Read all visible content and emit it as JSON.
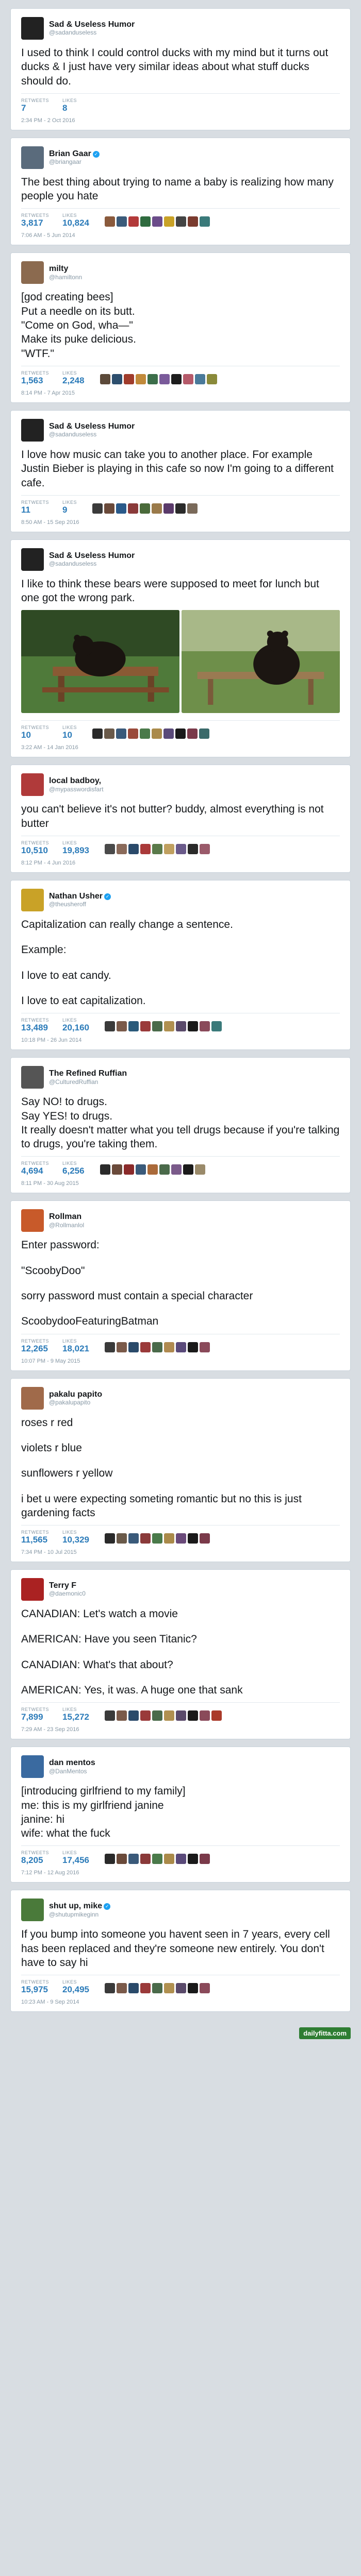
{
  "tweets": [
    {
      "name": "Sad & Useless Humor",
      "handle": "@sadanduseless",
      "verified": false,
      "avatar_color": "#222222",
      "text": [
        "I used to think I could control ducks with my mind but it turns out ducks & I just have very similar ideas about what stuff ducks should do."
      ],
      "retweets_label": "RETWEETS",
      "retweets": "7",
      "likes_label": "LIKES",
      "likes": "8",
      "liker_colors": [],
      "time": "2:34 PM - 2 Oct 2016"
    },
    {
      "name": "Brian Gaar",
      "handle": "@briangaar",
      "verified": true,
      "avatar_color": "#5a6b7c",
      "text": [
        "The best thing about trying to name a baby is realizing how many people you hate"
      ],
      "retweets_label": "RETWEETS",
      "retweets": "3,817",
      "likes_label": "LIKES",
      "likes": "10,824",
      "liker_colors": [
        "#8a5a3c",
        "#3b5b7a",
        "#b33a3a",
        "#2f6b3f",
        "#6b4c8a",
        "#c9a227",
        "#444444",
        "#7a3b2e",
        "#3a7a7a"
      ],
      "time": "7:06 AM - 5 Jun 2014"
    },
    {
      "name": "milty",
      "handle": "@hamiltonn",
      "verified": false,
      "avatar_color": "#8b6a4f",
      "text": [
        "[god creating bees]",
        "Put a needle on its butt.",
        "\"Come on God, wha—\"",
        "Make its puke delicious.",
        "\"WTF.\""
      ],
      "retweets_label": "RETWEETS",
      "retweets": "1,563",
      "likes_label": "LIKES",
      "likes": "2,248",
      "liker_colors": [
        "#5c4a3a",
        "#2d4f6e",
        "#a03c2c",
        "#c18a3b",
        "#3c6e4a",
        "#7a5a9a",
        "#1d1d1d",
        "#b55a6a",
        "#4a7a9a",
        "#8a8a3a"
      ],
      "time": "8:14 PM - 7 Apr 2015"
    },
    {
      "name": "Sad & Useless Humor",
      "handle": "@sadanduseless",
      "verified": false,
      "avatar_color": "#222222",
      "text": [
        "I love how music can take you to another place. For example Justin Bieber is playing in this cafe so now I'm going to a different cafe."
      ],
      "retweets_label": "RETWEETS",
      "retweets": "11",
      "likes_label": "LIKES",
      "likes": "9",
      "liker_colors": [
        "#3a3a3a",
        "#6a4a3a",
        "#2a5a8a",
        "#8a3a3a",
        "#4a6a3a",
        "#9a7a4a",
        "#5a3a6a",
        "#2a2a2a",
        "#7a6a5a"
      ],
      "time": "8:50 AM - 15 Sep 2016"
    },
    {
      "name": "Sad & Useless Humor",
      "handle": "@sadanduseless",
      "verified": false,
      "avatar_color": "#222222",
      "text": [
        "I like to think these bears were supposed to meet for lunch but one got the wrong park."
      ],
      "photos": true,
      "retweets_label": "RETWEETS",
      "retweets": "10",
      "likes_label": "LIKES",
      "likes": "10",
      "liker_colors": [
        "#2a2a2a",
        "#6a5a4a",
        "#3a5a7a",
        "#9a4a3a",
        "#4a7a4a",
        "#aa8a4a",
        "#5a4a7a",
        "#1a1a1a",
        "#7a3a4a",
        "#3a6a6a"
      ],
      "time": "3:22 AM - 14 Jan 2016"
    },
    {
      "name": "local badboy,",
      "handle": "@mypasswordisfart",
      "verified": false,
      "avatar_color": "#b03a3a",
      "text": [
        "you can't believe it's not butter? buddy, almost everything is not butter"
      ],
      "retweets_label": "RETWEETS",
      "retweets": "10,510",
      "likes_label": "LIKES",
      "likes": "19,893",
      "liker_colors": [
        "#4a4a4a",
        "#8a6a5a",
        "#2a4a6a",
        "#aa3a3a",
        "#5a7a4a",
        "#c0a060",
        "#6a5a8a",
        "#2a2a2a",
        "#9a5a6a"
      ],
      "time": "8:12 PM - 4 Jun 2016"
    },
    {
      "name": "Nathan Usher",
      "handle": "@theusheroff",
      "verified": true,
      "avatar_color": "#c9a227",
      "text": [
        "Capitalization can really change a sentence.",
        "",
        "Example:",
        "",
        "I love to eat candy.",
        "",
        "I love to eat capitalization."
      ],
      "retweets_label": "RETWEETS",
      "retweets": "13,489",
      "likes_label": "LIKES",
      "likes": "20,160",
      "liker_colors": [
        "#3a3a3a",
        "#7a5a4a",
        "#2a5a7a",
        "#9a3a3a",
        "#4a6a4a",
        "#b09050",
        "#5a4a6a",
        "#1a1a1a",
        "#8a4a5a",
        "#3a7a7a"
      ],
      "time": "10:18 PM - 26 Jun 2014"
    },
    {
      "name": "The Refined Ruffian",
      "handle": "@CulturedRuffian",
      "verified": false,
      "avatar_color": "#555555",
      "text": [
        "Say NO! to drugs.",
        "Say YES! to drugs.",
        "It really doesn't matter what you tell drugs because if you're talking to drugs, you're taking them."
      ],
      "retweets_label": "RETWEETS",
      "retweets": "4,694",
      "likes_label": "LIKES",
      "likes": "6,256",
      "liker_colors": [
        "#2a2a2a",
        "#6a4a3a",
        "#8a2a2a",
        "#3a5a7a",
        "#aa6a3a",
        "#4a6a4a",
        "#7a5a8a",
        "#1a1a1a",
        "#9a8a6a"
      ],
      "time": "8:11 PM - 30 Aug 2015"
    },
    {
      "name": "Rollman",
      "handle": "@Rollmanlol",
      "verified": false,
      "avatar_color": "#c85a2a",
      "text": [
        "Enter password:",
        "",
        "\"ScoobyDoo\"",
        "",
        "sorry password must contain a special character",
        "",
        "ScoobydooFeaturingBatman"
      ],
      "retweets_label": "RETWEETS",
      "retweets": "12,265",
      "likes_label": "LIKES",
      "likes": "18,021",
      "liker_colors": [
        "#3a3a3a",
        "#7a5a4a",
        "#2a4a6a",
        "#9a3a3a",
        "#4a6a4a",
        "#b08a50",
        "#5a4a7a",
        "#1a1a1a",
        "#8a4a5a"
      ],
      "time": "10:07 PM - 9 May 2015"
    },
    {
      "name": "pakalu papito",
      "handle": "@pakalupapito",
      "verified": false,
      "avatar_color": "#a06a4a",
      "text": [
        "roses r red",
        "",
        "violets r blue",
        "",
        "sunflowers r yellow",
        "",
        "i bet u were expecting someting romantic but no this is just gardening facts"
      ],
      "retweets_label": "RETWEETS",
      "retweets": "11,565",
      "likes_label": "LIKES",
      "likes": "10,329",
      "liker_colors": [
        "#2a2a2a",
        "#6a5a4a",
        "#3a5a7a",
        "#8a3a3a",
        "#4a7a4a",
        "#aa8a4a",
        "#6a4a7a",
        "#1a1a1a",
        "#7a3a4a"
      ],
      "time": "7:34 PM - 10 Jul 2015"
    },
    {
      "name": "Terry F",
      "handle": "@daemonic0",
      "verified": false,
      "avatar_color": "#aa2222",
      "text": [
        "CANADIAN: Let's watch a movie",
        "",
        "AMERICAN: Have you seen Titanic?",
        "",
        "CANADIAN: What's that about?",
        "",
        "AMERICAN: Yes, it was. A huge one that sank"
      ],
      "retweets_label": "RETWEETS",
      "retweets": "7,899",
      "likes_label": "LIKES",
      "likes": "15,272",
      "liker_colors": [
        "#3a3a3a",
        "#7a5a4a",
        "#2a4a6a",
        "#9a3a3a",
        "#4a6a4a",
        "#b09050",
        "#5a4a6a",
        "#1a1a1a",
        "#8a4a5a",
        "#aa3a2a"
      ],
      "time": "7:29 AM - 23 Sep 2016"
    },
    {
      "name": "dan mentos",
      "handle": "@DanMentos",
      "verified": false,
      "avatar_color": "#3a6aa0",
      "text": [
        "[introducing girlfriend to my family]",
        "me: this is my girlfriend janine",
        "janine: hi",
        "wife: what the fuck"
      ],
      "retweets_label": "RETWEETS",
      "retweets": "8,205",
      "likes_label": "LIKES",
      "likes": "17,456",
      "liker_colors": [
        "#2a2a2a",
        "#6a4a3a",
        "#3a5a7a",
        "#8a3a3a",
        "#4a7a4a",
        "#aa8a4a",
        "#5a4a7a",
        "#1a1a1a",
        "#7a3a4a"
      ],
      "time": "7:12 PM - 12 Aug 2016"
    },
    {
      "name": "shut up, mike",
      "handle": "@shutupmikeginn",
      "verified": true,
      "avatar_color": "#4a7a3a",
      "text": [
        "If you bump into someone you havent seen in 7 years, every cell has been replaced and they're someone new entirely. You don't have to say hi"
      ],
      "retweets_label": "RETWEETS",
      "retweets": "15,975",
      "likes_label": "LIKES",
      "likes": "20,495",
      "liker_colors": [
        "#3a3a3a",
        "#7a5a4a",
        "#2a4a6a",
        "#9a3a3a",
        "#4a6a4a",
        "#b09050",
        "#5a4a6a",
        "#1a1a1a",
        "#8a4a5a"
      ],
      "time": "10:23 AM - 9 Sep 2014"
    }
  ],
  "site_logo": "dailyfitta.com"
}
